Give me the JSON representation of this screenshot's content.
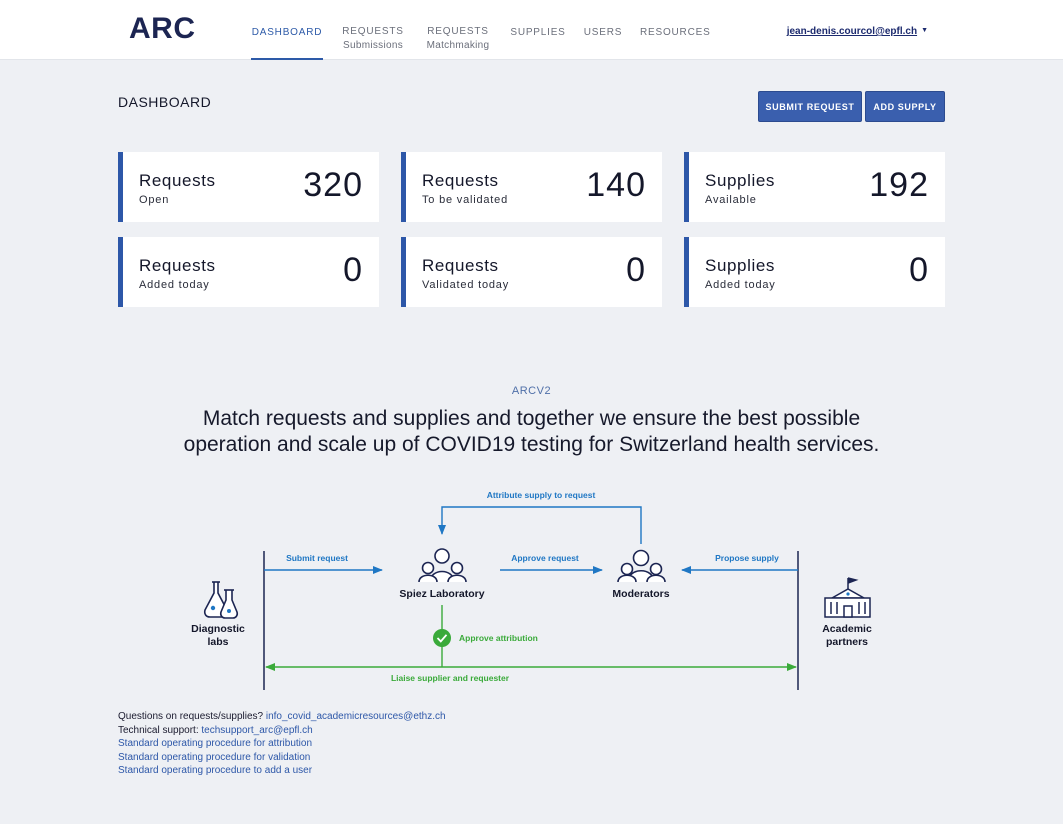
{
  "header": {
    "logo": "ARC",
    "nav": [
      {
        "label": "DASHBOARD",
        "sub": ""
      },
      {
        "label": "REQUESTS",
        "sub": "Submissions"
      },
      {
        "label": "REQUESTS",
        "sub": "Matchmaking"
      },
      {
        "label": "SUPPLIES",
        "sub": ""
      },
      {
        "label": "USERS",
        "sub": ""
      },
      {
        "label": "RESOURCES",
        "sub": ""
      }
    ],
    "user": "jean-denis.courcol@epfl.ch"
  },
  "page": {
    "title": "DASHBOARD",
    "submit_request": "SUBMIT REQUEST",
    "add_supply": "ADD SUPPLY"
  },
  "cards": [
    {
      "title": "Requests",
      "sub": "Open",
      "value": "320"
    },
    {
      "title": "Requests",
      "sub": "To be validated",
      "value": "140"
    },
    {
      "title": "Supplies",
      "sub": "Available",
      "value": "192"
    },
    {
      "title": "Requests",
      "sub": "Added today",
      "value": "0"
    },
    {
      "title": "Requests",
      "sub": "Validated today",
      "value": "0"
    },
    {
      "title": "Supplies",
      "sub": "Added today",
      "value": "0"
    }
  ],
  "intro": {
    "eyebrow": "ARCV2",
    "line1": "Match requests and supplies and together we ensure the best possible",
    "line2": "operation and scale up of COVID19 testing for Switzerland health services."
  },
  "diagram": {
    "attribute": "Attribute supply to request",
    "submit": "Submit  request",
    "approve_request": "Approve request",
    "propose": "Propose supply",
    "spiez": "Spiez Laboratory",
    "moderators": "Moderators",
    "diag1": "Diagnostic",
    "diag2": "labs",
    "acad1": "Academic",
    "acad2": "partners",
    "approve_attr": "Approve attribution",
    "liaise": "Liaise supplier and requester",
    "blue": "#1f77c4",
    "green": "#3aaa3a"
  },
  "footer": {
    "q_label": "Questions on requests/supplies?",
    "q_email": "info_covid_academicresources@ethz.ch",
    "t_label": "Technical support:",
    "t_email": "techsupport_arc@epfl.ch",
    "sop1": "Standard operating procedure for attribution",
    "sop2": "Standard operating procedure for validation",
    "sop3": "Standard operating procedure to add a user"
  }
}
